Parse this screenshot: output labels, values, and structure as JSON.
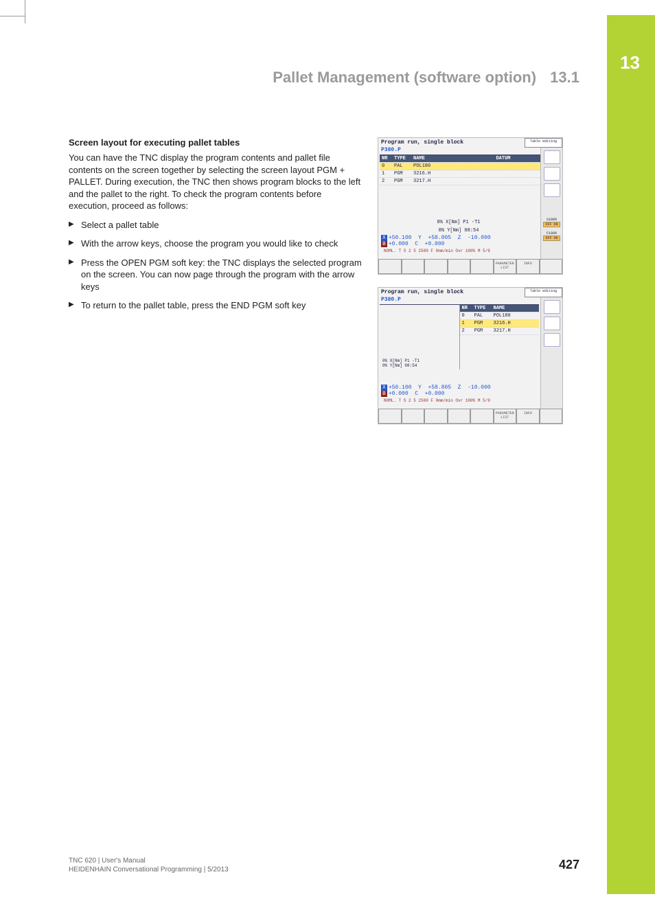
{
  "chapter": {
    "number": "13",
    "title": "Pallet Management (software option)",
    "section_num": "13.1"
  },
  "subheading": "Screen layout for executing pallet tables",
  "paragraph": "You can have the TNC display the program contents and pallet file contents on the screen together by selecting the screen layout PGM + PALLET. During execution, the TNC then shows program blocks to the left and the pallet to the right. To check the program contents before execution, proceed as follows:",
  "bullets": [
    "Select a pallet table",
    "With the arrow keys, choose the program you would like to check",
    "Press the OPEN PGM soft key: the TNC displays the selected program on the screen. You can now page through the program with the arrow keys",
    "To return to the pallet table, press the END PGM soft key"
  ],
  "screenshot1": {
    "title": "Program run, single block",
    "modebox": "Table editing",
    "file": "P380.P",
    "headers": {
      "nr": "NR",
      "type": "TYPE",
      "name": "NAME",
      "datum": "DATUM"
    },
    "rows": [
      {
        "nr": "0",
        "type": "PAL",
        "name": "POL180",
        "hl": true
      },
      {
        "nr": "1",
        "type": "PGM",
        "name": "3216.H"
      },
      {
        "nr": "2",
        "type": "PGM",
        "name": "3217.H"
      }
    ],
    "midline1": "0% X[Nm] P1  -T1",
    "midline2": "0% Y[Nm] 08:54",
    "coords": {
      "x": "X",
      "xv": "+50.100",
      "y": "Y",
      "yv": "+58.805",
      "z": "Z",
      "zv": "-10.000",
      "b": "B",
      "bv": "+0.000",
      "c": "C",
      "cv": "+0.000"
    },
    "status": "NOML.   T   S 2 5 2500 F   0mm/min   Ovr 100% M 5/9",
    "softkeys": [
      "",
      "",
      "",
      "",
      "",
      "PARAMETER LIST",
      "INFO",
      ""
    ],
    "sidelabels": [
      "",
      "",
      "",
      "S100%",
      "OFF  ON",
      "F100%",
      "OFF  ON"
    ]
  },
  "screenshot2": {
    "title": "Program run, single block",
    "modebox": "Table editing",
    "file": "P380.P",
    "left_lines": [
      "0% X[Nm] P1  -T1",
      "0% Y[Nm] 08:54"
    ],
    "rheaders": {
      "nr": "NR",
      "type": "TYPE",
      "name": "NAME"
    },
    "rrows": [
      {
        "nr": "0",
        "type": "PAL",
        "name": "POL180"
      },
      {
        "nr": "1",
        "type": "PGM",
        "name": "3216.H",
        "hl": true
      },
      {
        "nr": "2",
        "type": "PGM",
        "name": "3217.H"
      }
    ],
    "coords": {
      "x": "X",
      "xv": "+50.100",
      "y": "Y",
      "yv": "+58.805",
      "z": "Z",
      "zv": "-10.000",
      "b": "B",
      "bv": "+0.000",
      "c": "C",
      "cv": "+0.000"
    },
    "status": "NOML.   T   S 2 5 2500 F   0mm/min   Ovr 100% M 5/9",
    "softkeys": [
      "",
      "",
      "",
      "",
      "",
      "PARAMETER LIST",
      "INFO",
      ""
    ]
  },
  "footer": {
    "line1": "TNC 620 | User's Manual",
    "line2": "HEIDENHAIN Conversational Programming | 5/2013",
    "page": "427"
  }
}
